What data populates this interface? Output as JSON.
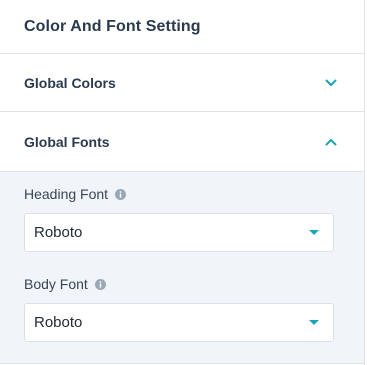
{
  "header": {
    "title": "Color And Font Setting"
  },
  "sections": {
    "global_colors": {
      "title": "Global Colors",
      "expanded": false
    },
    "global_fonts": {
      "title": "Global Fonts",
      "expanded": true,
      "fields": {
        "heading": {
          "label": "Heading Font",
          "value": "Roboto",
          "info_icon": "info-icon"
        },
        "body": {
          "label": "Body Font",
          "value": "Roboto",
          "info_icon": "info-icon"
        }
      }
    }
  },
  "colors": {
    "accent": "#1ba6b8",
    "info": "#9aa8b6",
    "section_bg": "#f1f5f9",
    "border": "#dfe4ea"
  },
  "icons": {
    "collapsed": "chevron-down-icon",
    "expanded": "chevron-up-icon",
    "dropdown": "caret-down-icon"
  }
}
